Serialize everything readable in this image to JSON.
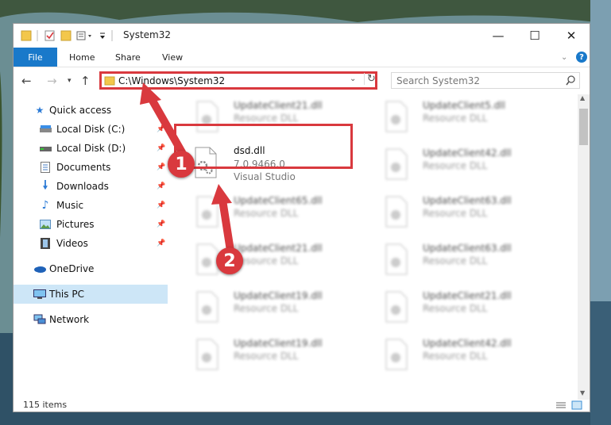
{
  "window": {
    "title": "System32",
    "controls": {
      "minimize": "—",
      "maximize": "☐",
      "close": "✕"
    }
  },
  "ribbon": {
    "tabs": [
      "File",
      "Home",
      "Share",
      "View"
    ],
    "help": "?"
  },
  "address": {
    "path": "C:\\Windows\\System32",
    "search_placeholder": "Search System32"
  },
  "nav_pane": {
    "items": [
      {
        "label": "Quick access",
        "icon": "star-icon",
        "pinned": false
      },
      {
        "label": "Local Disk (C:)",
        "icon": "drive-icon",
        "pinned": true
      },
      {
        "label": "Local Disk (D:)",
        "icon": "drive-icon",
        "pinned": true
      },
      {
        "label": "Documents",
        "icon": "documents-icon",
        "pinned": true
      },
      {
        "label": "Downloads",
        "icon": "download-icon",
        "pinned": true
      },
      {
        "label": "Music",
        "icon": "music-icon",
        "pinned": true
      },
      {
        "label": "Pictures",
        "icon": "pictures-icon",
        "pinned": true
      },
      {
        "label": "Videos",
        "icon": "videos-icon",
        "pinned": true
      },
      {
        "label": "OneDrive",
        "icon": "cloud-icon",
        "pinned": false
      },
      {
        "label": "This PC",
        "icon": "computer-icon",
        "pinned": false,
        "selected": true
      },
      {
        "label": "Network",
        "icon": "network-icon",
        "pinned": false
      }
    ]
  },
  "files": {
    "highlighted": {
      "name": "dsd.dll",
      "version": "7.0.9466.0",
      "company": "Visual Studio"
    },
    "left_column": [
      {
        "name": "UpdateClient21.dll",
        "type": "Resource DLL"
      },
      {
        "name": "UpdateClient65.dll",
        "type": "Resource DLL"
      },
      {
        "name": "UpdateClient21.dll",
        "type": "Resource DLL"
      },
      {
        "name": "UpdateClient19.dll",
        "type": "Resource DLL"
      },
      {
        "name": "UpdateClient19.dll",
        "type": "Resource DLL"
      }
    ],
    "right_column": [
      {
        "name": "UpdateClient5.dll",
        "type": "Resource DLL"
      },
      {
        "name": "UpdateClient42.dll",
        "type": "Resource DLL"
      },
      {
        "name": "UpdateClient63.dll",
        "type": "Resource DLL"
      },
      {
        "name": "UpdateClient63.dll",
        "type": "Resource DLL"
      },
      {
        "name": "UpdateClient21.dll",
        "type": "Resource DLL"
      },
      {
        "name": "UpdateClient42.dll",
        "type": "Resource DLL"
      }
    ]
  },
  "status": {
    "item_count": "115 items"
  },
  "annotations": {
    "step1": "1",
    "step2": "2"
  },
  "colors": {
    "accent": "#1979ca",
    "highlight": "#d9393e",
    "selection": "#cde6f7"
  }
}
